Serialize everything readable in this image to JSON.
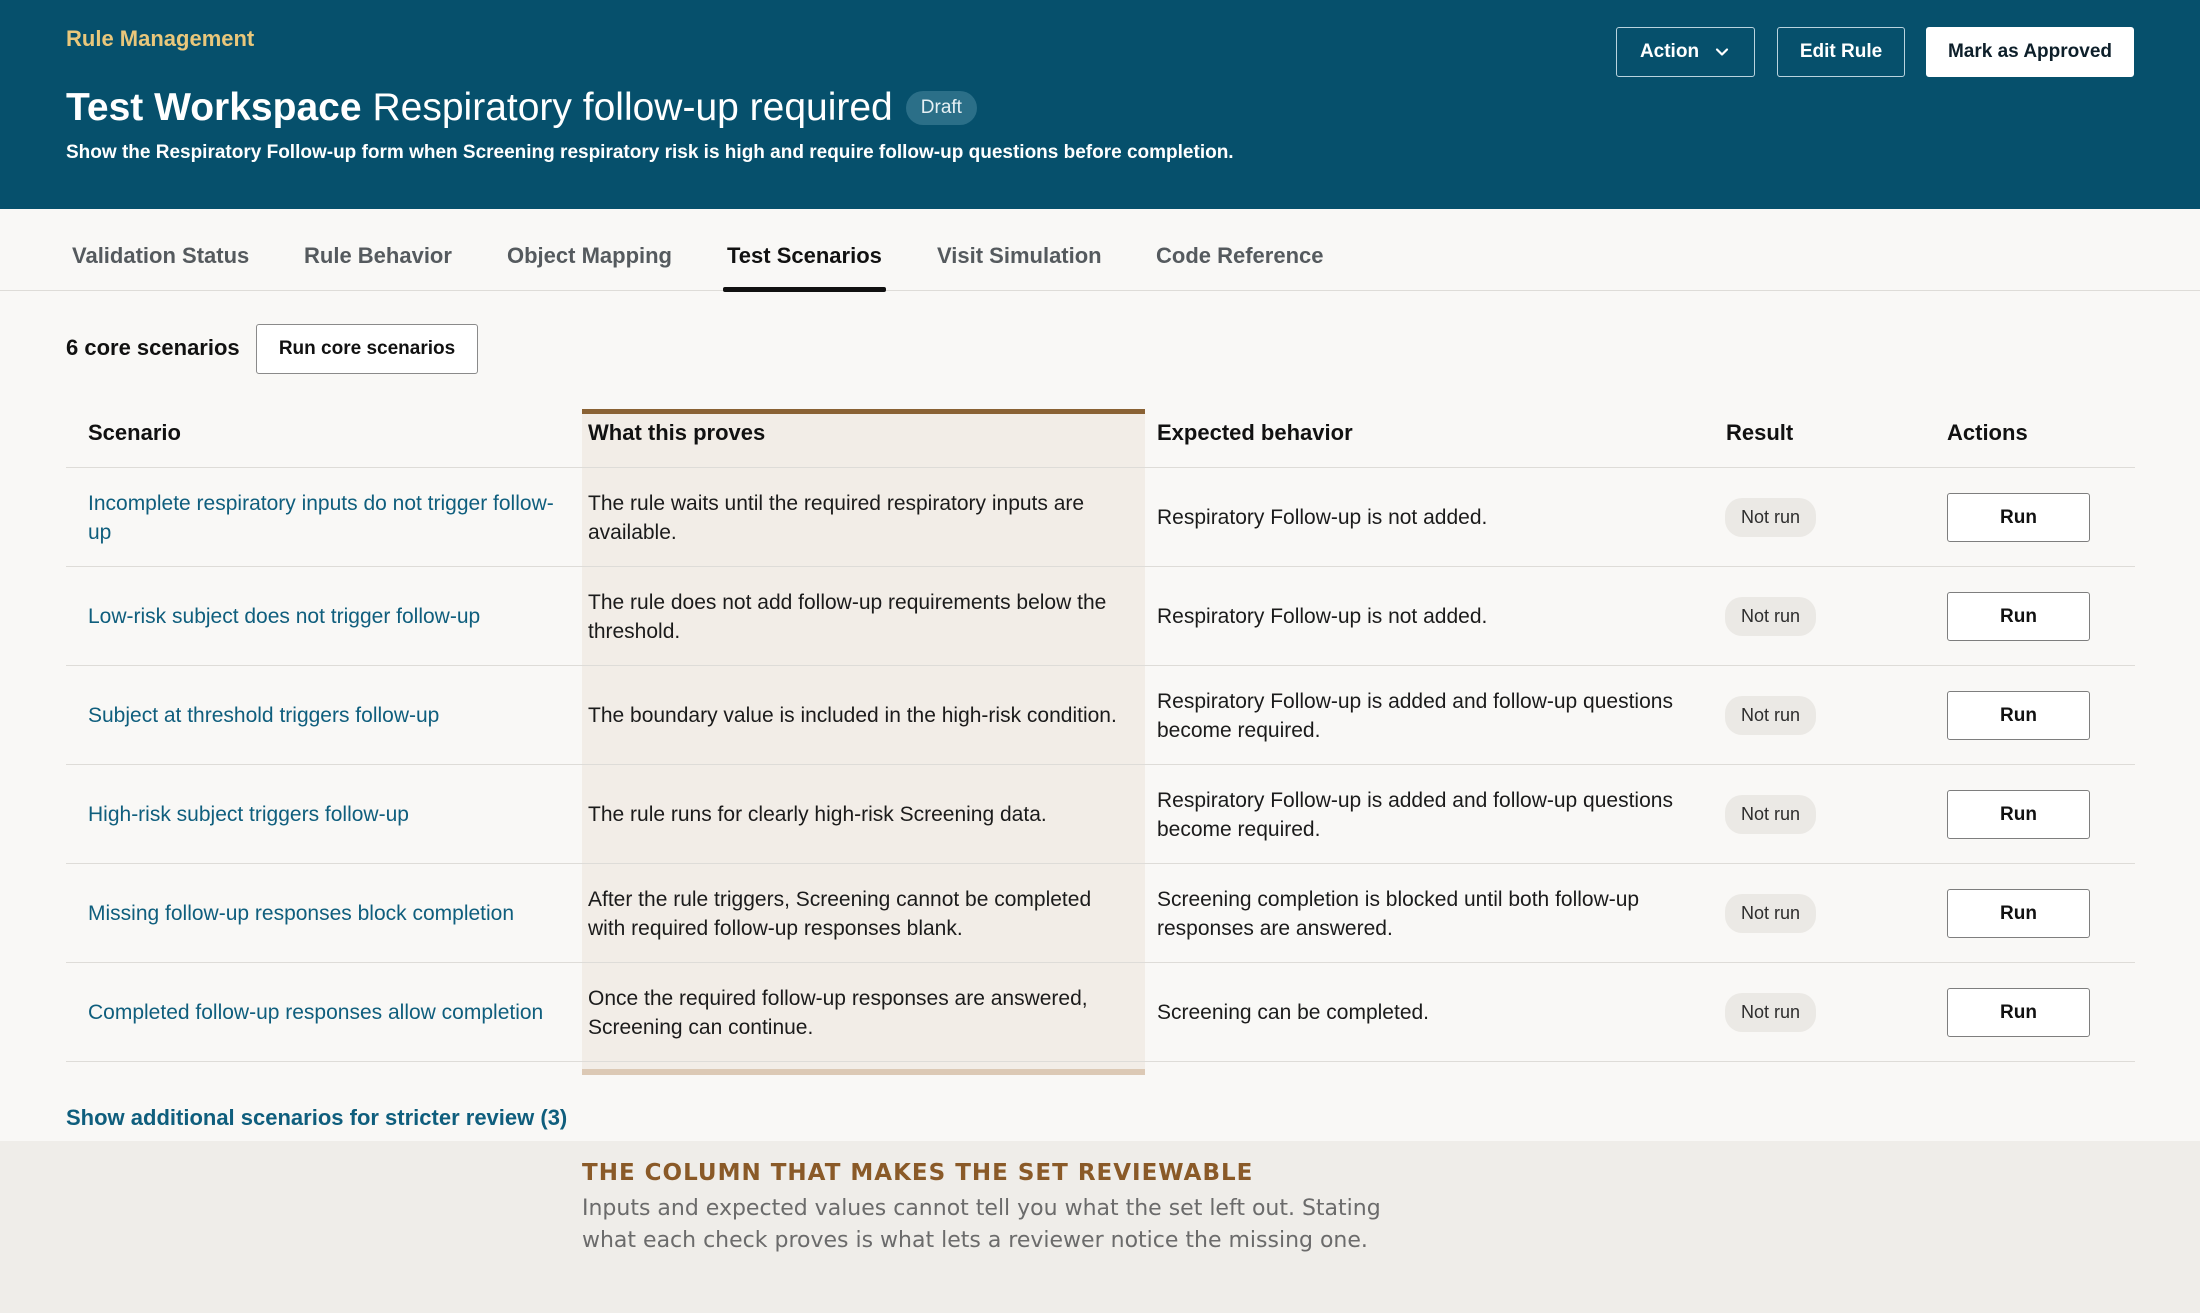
{
  "header": {
    "eyebrow": "Rule Management",
    "title_bold": "Test Workspace",
    "title_rest": "Respiratory follow-up required",
    "status_badge": "Draft",
    "description": "Show the Respiratory Follow-up form when Screening respiratory risk is high and require follow-up questions before completion.",
    "buttons": {
      "action": "Action",
      "edit": "Edit Rule",
      "approve": "Mark as Approved"
    }
  },
  "tabs": [
    {
      "label": "Validation Status"
    },
    {
      "label": "Rule Behavior"
    },
    {
      "label": "Object Mapping"
    },
    {
      "label": "Test Scenarios",
      "active": true
    },
    {
      "label": "Visit Simulation"
    },
    {
      "label": "Code Reference"
    }
  ],
  "toolbar": {
    "count_label": "6 core scenarios",
    "run_core_label": "Run core scenarios"
  },
  "table": {
    "columns": [
      "Scenario",
      "What this proves",
      "Expected behavior",
      "Result",
      "Actions"
    ],
    "rows": [
      {
        "scenario": "Incomplete respiratory inputs do not trigger follow-up",
        "proves": "The rule waits until the required respiratory inputs are available.",
        "expected": "Respiratory Follow-up is not added.",
        "result": "Not run",
        "action": "Run"
      },
      {
        "scenario": "Low-risk subject does not trigger follow-up",
        "proves": "The rule does not add follow-up requirements below the threshold.",
        "expected": "Respiratory Follow-up is not added.",
        "result": "Not run",
        "action": "Run"
      },
      {
        "scenario": "Subject at threshold triggers follow-up",
        "proves": "The boundary value is included in the high-risk condition.",
        "expected": "Respiratory Follow-up is added and follow-up questions become required.",
        "result": "Not run",
        "action": "Run"
      },
      {
        "scenario": "High-risk subject triggers follow-up",
        "proves": "The rule runs for clearly high-risk Screening data.",
        "expected": "Respiratory Follow-up is added and follow-up questions become required.",
        "result": "Not run",
        "action": "Run"
      },
      {
        "scenario": "Missing follow-up responses block completion",
        "proves": "After the rule triggers, Screening cannot be completed with required follow-up responses blank.",
        "expected": "Screening completion is blocked until both follow-up responses are answered.",
        "result": "Not run",
        "action": "Run"
      },
      {
        "scenario": "Completed follow-up responses allow completion",
        "proves": "Once the required follow-up responses are answered, Screening can continue.",
        "expected": "Screening can be completed.",
        "result": "Not run",
        "action": "Run"
      }
    ]
  },
  "show_more": "Show additional scenarios for stricter review (3)",
  "callout": {
    "title": "THE COLUMN THAT MAKES THE SET REVIEWABLE",
    "body": "Inputs and expected values cannot tell you what the set left out. Stating what each check proves is what lets a reviewer notice the missing one."
  },
  "colors": {
    "header_bg": "#06506c",
    "eyebrow": "#e9c77b",
    "link": "#0f5e7d",
    "highlight_column_bg": "#f2ede7",
    "highlight_column_border": "#8a6234",
    "callout_title": "#8a5a28"
  },
  "icons": {
    "action_dropdown": "chevron-down-icon"
  }
}
